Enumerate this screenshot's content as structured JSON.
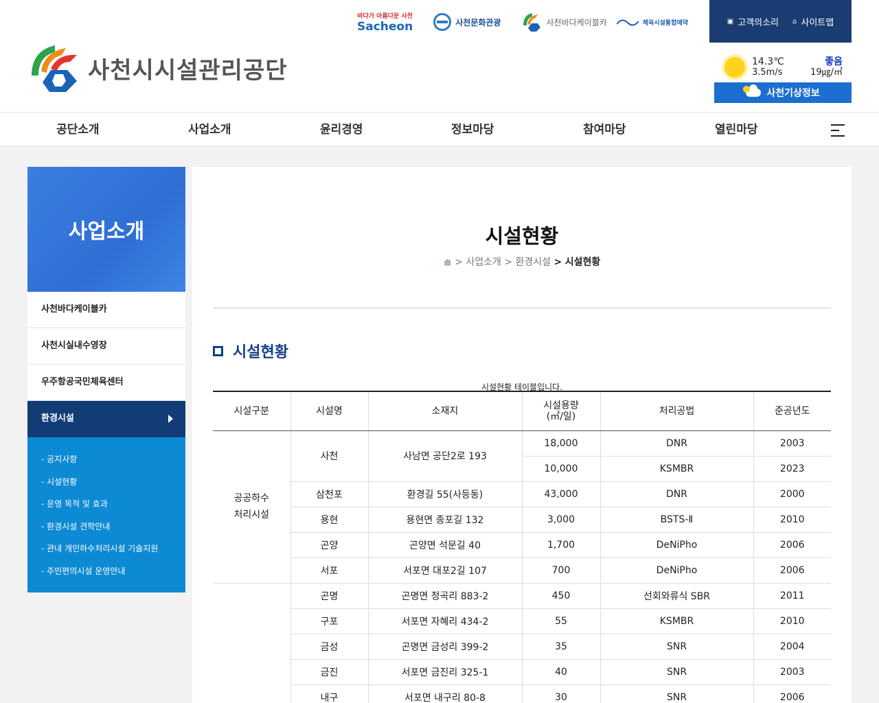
{
  "header": {
    "org_name": "사천시시설관리공단",
    "partners": {
      "sacheon_tagline": "바다가 아름다운 사천",
      "sacheon": "Sacheon",
      "culture": "사천문화관광",
      "cable": "사천바다케이블카",
      "sport": "체육시설통합예약"
    },
    "top_links": [
      {
        "label": "고객의소리",
        "icon": "note-icon"
      },
      {
        "label": "사이트맵",
        "icon": "home-icon"
      }
    ],
    "weather": {
      "temp": "14.3℃",
      "wind": "3.5m/s",
      "air_status": "좋음",
      "air_value": "19㎍/㎥",
      "button": "사천기상정보"
    }
  },
  "gnb": [
    "공단소개",
    "사업소개",
    "윤리경영",
    "정보마당",
    "참여마당",
    "열린마당"
  ],
  "side": {
    "title": "사업소개",
    "items": [
      "사천바다케이블카",
      "사천시실내수영장",
      "우주항공국민체육센터",
      "환경시설"
    ],
    "active": "환경시설",
    "sub_items": [
      "- 공지사항",
      "- 시설현황",
      "- 운영 목적 및 효과",
      "- 환경시설 견학안내",
      "- 관내 개인하수처리시설 기술지원",
      "- 주민편의시설 운영안내"
    ]
  },
  "content": {
    "title": "시설현황",
    "breadcrumb": [
      ">",
      "사업소개",
      ">",
      "환경시설",
      ">",
      "시설현황"
    ],
    "section_title": "시설현황",
    "caption": "시설현황 테이블입니다.",
    "headers": [
      "시설구분",
      "시설명",
      "소재지",
      "시설용량\n(㎥/일)",
      "처리공법",
      "준공년도"
    ],
    "group1": "공공하수\n처리시설",
    "rows": [
      [
        "사천",
        "사남면 공단2로 193",
        "18,000",
        "DNR",
        "2003"
      ],
      [
        "",
        "",
        "10,000",
        "KSMBR",
        "2023"
      ],
      [
        "삼천포",
        "환경길 55(사등동)",
        "43,000",
        "DNR",
        "2000"
      ],
      [
        "용현",
        "용현면 종포길 132",
        "3,000",
        "BSTS-Ⅱ",
        "2010"
      ],
      [
        "곤양",
        "곤양면 석문길 40",
        "1,700",
        "DeNiPho",
        "2006"
      ],
      [
        "서포",
        "서포면 대포2길 107",
        "700",
        "DeNiPho",
        "2006"
      ],
      [
        "곤명",
        "곤명면 정곡리 883-2",
        "450",
        "선회와류식 SBR",
        "2011"
      ],
      [
        "구포",
        "서포면 자혜리 434-2",
        "55",
        "KSMBR",
        "2010"
      ],
      [
        "금성",
        "곤명면 금성리 399-2",
        "35",
        "SNR",
        "2004"
      ],
      [
        "금진",
        "서포면 금진리 325-1",
        "40",
        "SNR",
        "2003"
      ],
      [
        "내구",
        "서포면 내구리 80-8",
        "30",
        "SNR",
        "2006"
      ]
    ]
  }
}
